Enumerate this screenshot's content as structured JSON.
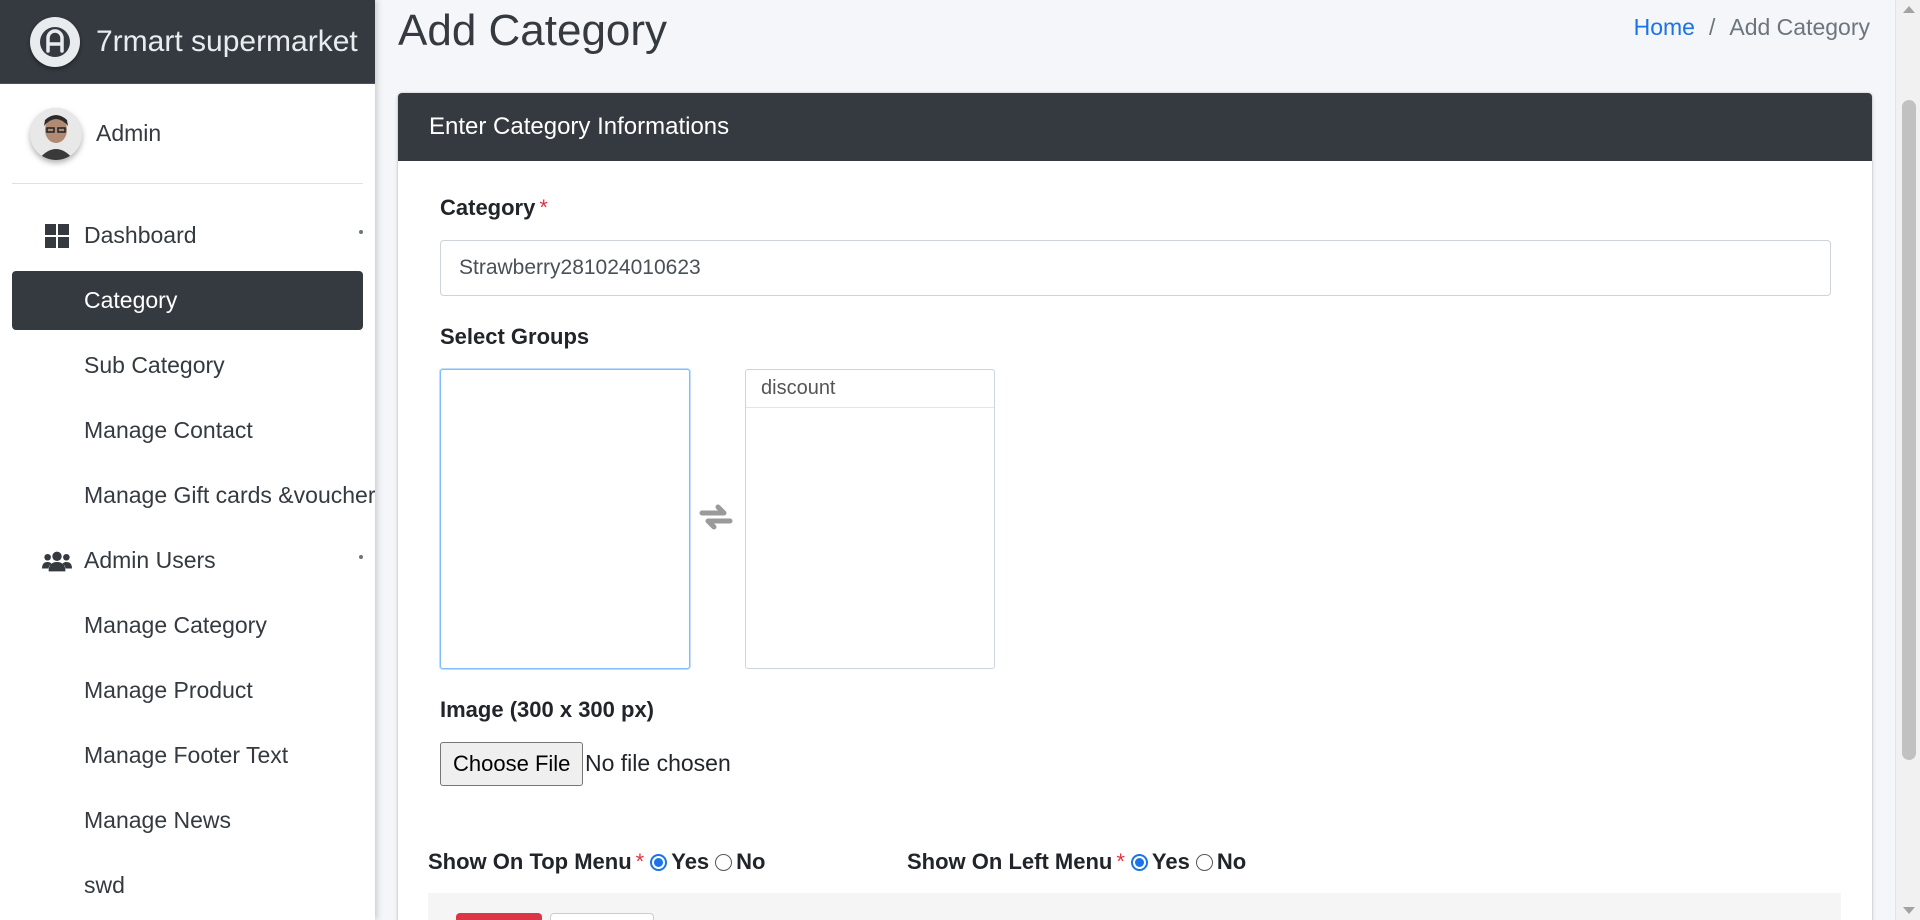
{
  "brand": {
    "name": "7rmart supermarket"
  },
  "user": {
    "name": "Admin"
  },
  "sidebar": {
    "items": [
      {
        "label": "Dashboard",
        "icon": "dashboard-icon",
        "has_submenu": true
      },
      {
        "label": "Category",
        "active": true
      },
      {
        "label": "Sub Category"
      },
      {
        "label": "Manage Contact"
      },
      {
        "label": "Manage Gift cards &voucher"
      },
      {
        "label": "Admin Users",
        "icon": "users-icon",
        "has_submenu": true
      },
      {
        "label": "Manage Category"
      },
      {
        "label": "Manage Product"
      },
      {
        "label": "Manage Footer Text"
      },
      {
        "label": "Manage News"
      },
      {
        "label": "swd"
      }
    ]
  },
  "header": {
    "title": "Add Category",
    "breadcrumb": {
      "home": "Home",
      "separator": "/",
      "current": "Add Category"
    }
  },
  "form": {
    "card_title": "Enter Category Informations",
    "category_label": "Category",
    "required_mark": "*",
    "category_value": "Strawberry281024010623",
    "groups_label": "Select Groups",
    "available_groups": [],
    "selected_groups": [
      "discount"
    ],
    "image_label": "Image (300 x 300 px)",
    "file_button": "Choose File",
    "file_status": "No file chosen",
    "top_menu_label": "Show On Top Menu",
    "left_menu_label": "Show On Left Menu",
    "yes_label": "Yes",
    "no_label": "No",
    "top_menu_value": "Yes",
    "left_menu_value": "Yes"
  },
  "colors": {
    "dark": "#343a40",
    "link": "#1a73e8",
    "danger": "#dc3545",
    "focus": "#80bdff"
  }
}
